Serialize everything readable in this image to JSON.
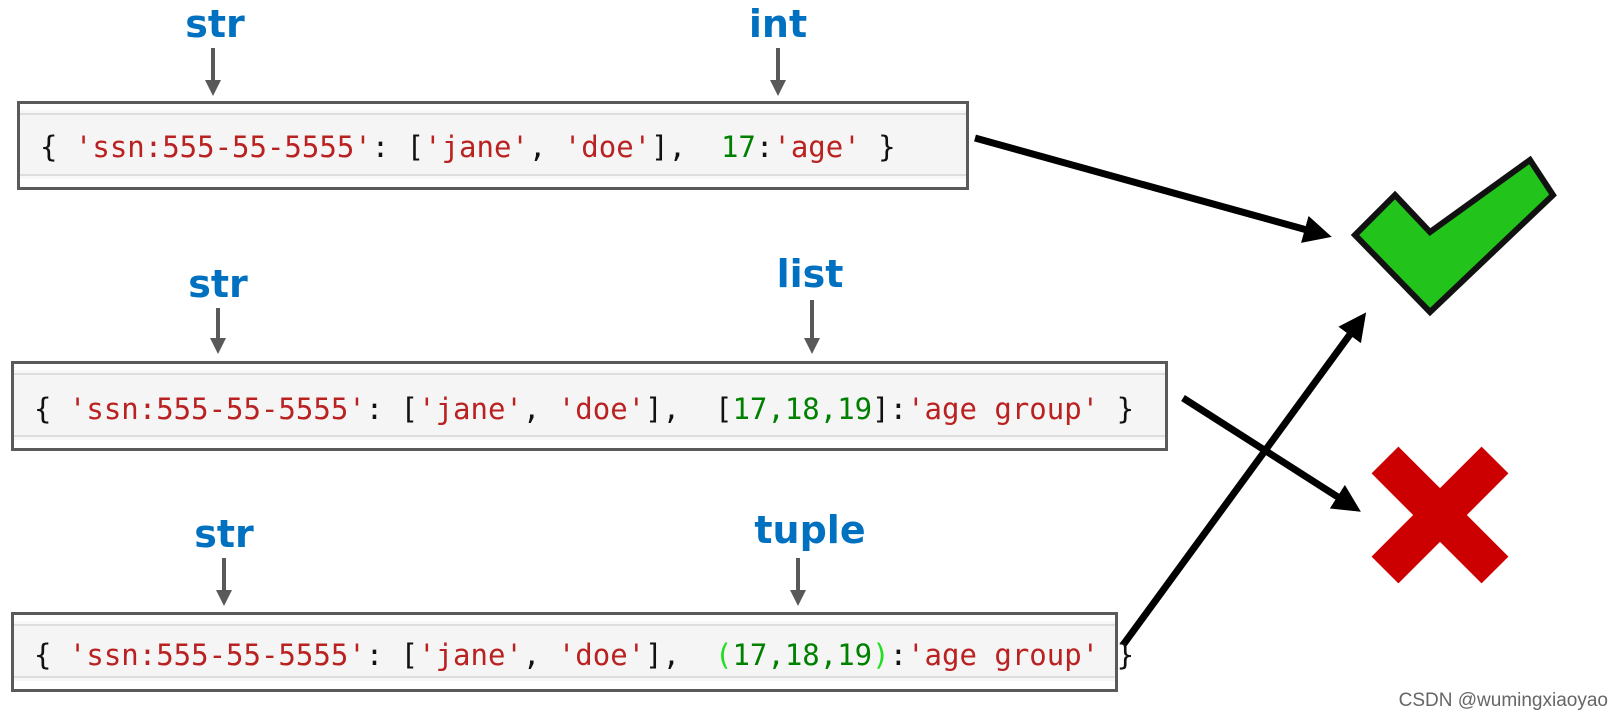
{
  "rows": [
    {
      "key_label": "str",
      "value_label": "int",
      "code": {
        "open": "{ ",
        "key": "'ssn:555-55-5555'",
        "colon": ": ",
        "list_open": "[",
        "jane": "'jane'",
        "comma": ", ",
        "doe": "'doe'",
        "list_close": "],  ",
        "k2_open": "",
        "k2": "17",
        "k2_close": "",
        "colon2": ":",
        "v2": "'age'",
        "close": " }"
      },
      "result": "valid"
    },
    {
      "key_label": "str",
      "value_label": "list",
      "code": {
        "open": "{ ",
        "key": "'ssn:555-55-5555'",
        "colon": ": ",
        "list_open": "[",
        "jane": "'jane'",
        "comma": ", ",
        "doe": "'doe'",
        "list_close": "],  ",
        "k2_open": "[",
        "k2": "17,18,19",
        "k2_close": "]",
        "colon2": ":",
        "v2": "'age group'",
        "close": " }"
      },
      "result": "invalid"
    },
    {
      "key_label": "str",
      "value_label": "tuple",
      "code": {
        "open": "{ ",
        "key": "'ssn:555-55-5555'",
        "colon": ": ",
        "list_open": "[",
        "jane": "'jane'",
        "comma": ", ",
        "doe": "'doe'",
        "list_close": "],  ",
        "k2_open": "(",
        "k2": "17,18,19",
        "k2_close": ")",
        "colon2": ":",
        "v2": "'age group'",
        "close": " }"
      },
      "result": "valid"
    }
  ],
  "colors": {
    "label": "#0070c0",
    "string": "#ba2121",
    "number": "#008000",
    "check": "#22c31a",
    "cross": "#cc0000"
  },
  "icons": {
    "valid": "check-mark-icon",
    "invalid": "cross-mark-icon"
  },
  "watermark": "CSDN @wumingxiaoyao"
}
